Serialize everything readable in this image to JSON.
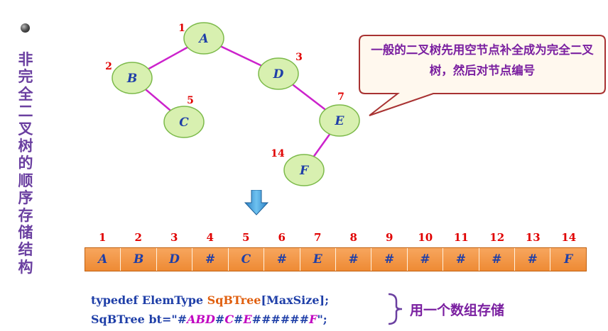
{
  "title": "非完全二叉树的顺序存储结构",
  "nodes": [
    {
      "label": "A",
      "index": "1"
    },
    {
      "label": "B",
      "index": "2"
    },
    {
      "label": "D",
      "index": "3"
    },
    {
      "label": "C",
      "index": "5"
    },
    {
      "label": "E",
      "index": "7"
    },
    {
      "label": "F",
      "index": "14"
    }
  ],
  "callout": "一般的二叉树先用空节点补全成为完全二叉树，然后对节点编号",
  "array_indices": [
    "1",
    "2",
    "3",
    "4",
    "5",
    "6",
    "7",
    "8",
    "9",
    "10",
    "11",
    "12",
    "13",
    "14"
  ],
  "array_values": [
    "A",
    "B",
    "D",
    "#",
    "C",
    "#",
    "E",
    "#",
    "#",
    "#",
    "#",
    "#",
    "#",
    "F"
  ],
  "code": {
    "line1_prefix": "typedef  ElemType  ",
    "line1_type": "SqBTree",
    "line1_suffix": "[MaxSize];",
    "line2_prefix": "SqBTree bt=\"#",
    "line2_seq": [
      {
        "text": "ABD",
        "style": "it"
      },
      {
        "text": "#",
        "style": "plain"
      },
      {
        "text": "C",
        "style": "it"
      },
      {
        "text": "#",
        "style": "plain"
      },
      {
        "text": "E",
        "style": "it"
      },
      {
        "text": "######",
        "style": "plain"
      },
      {
        "text": "F",
        "style": "it"
      }
    ],
    "line2_suffix": "\";"
  },
  "note": "用一个数组存储",
  "colors": {
    "edge": "#cc22cc",
    "node_fill": "#d8f0b0",
    "node_stroke": "#7cba4a",
    "index": "#e00000",
    "callout_stroke": "#a83232",
    "callout_fill": "#fff8ee",
    "array_fill": "#f29540"
  }
}
